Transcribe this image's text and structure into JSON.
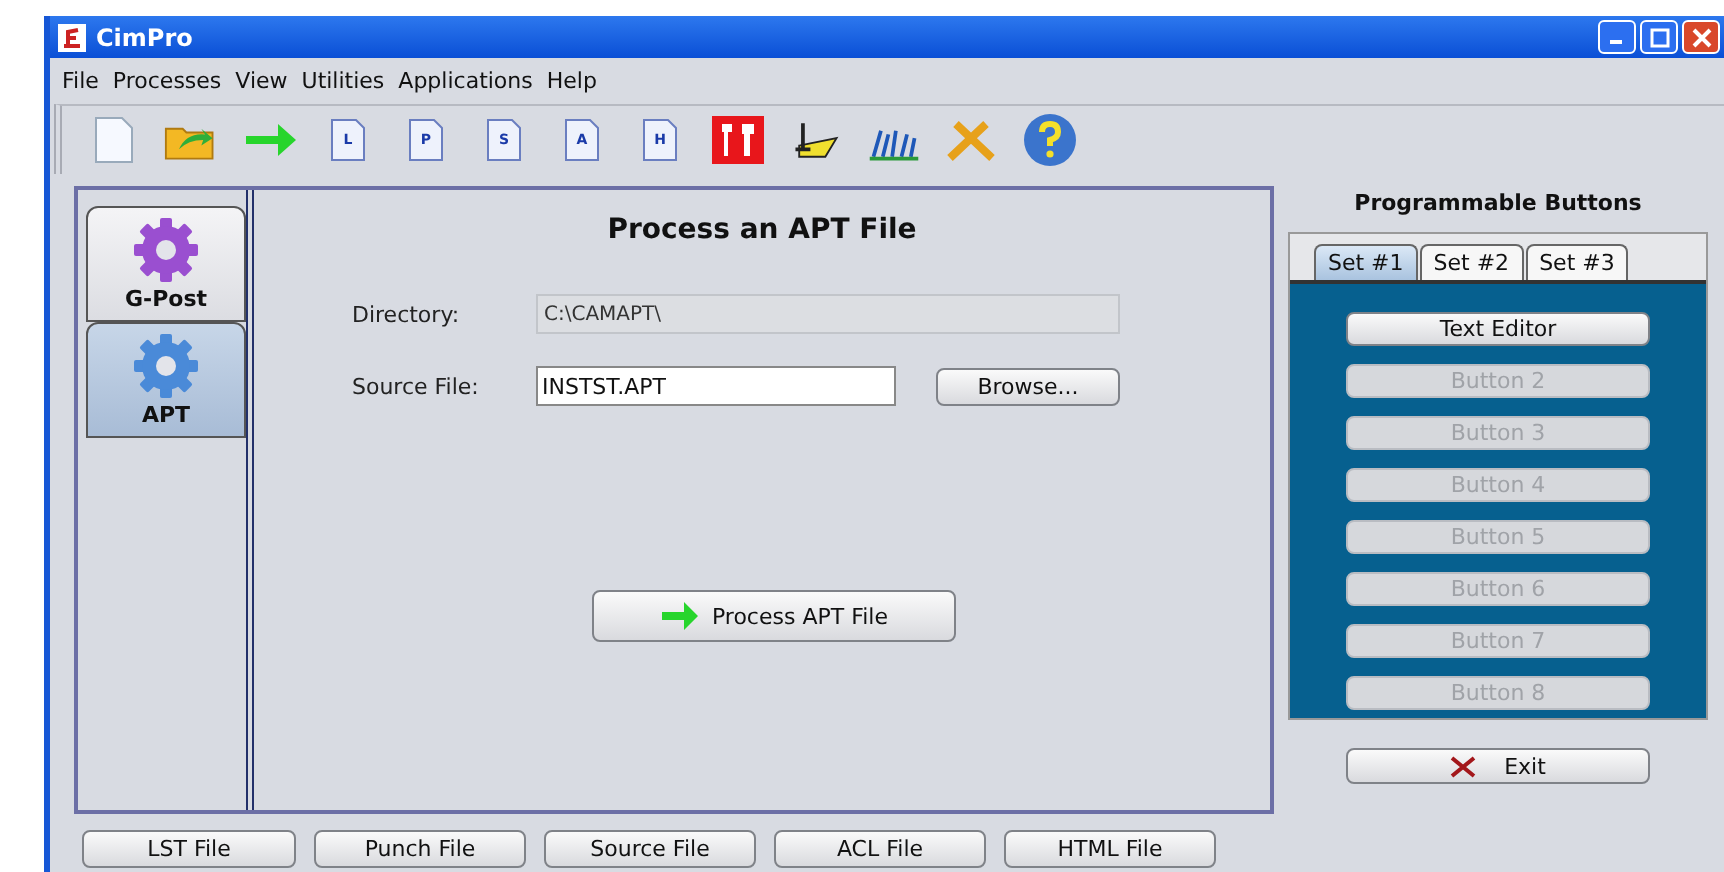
{
  "window": {
    "title": "CimPro"
  },
  "menu": [
    "File",
    "Processes",
    "View",
    "Utilities",
    "Applications",
    "Help"
  ],
  "toolbar": [
    {
      "kind": "new"
    },
    {
      "kind": "open"
    },
    {
      "kind": "go"
    },
    {
      "kind": "doc",
      "letter": "L"
    },
    {
      "kind": "doc",
      "letter": "P"
    },
    {
      "kind": "doc",
      "letter": "S"
    },
    {
      "kind": "doc",
      "letter": "A"
    },
    {
      "kind": "doc",
      "letter": "H"
    },
    {
      "kind": "tools-red"
    },
    {
      "kind": "pen"
    },
    {
      "kind": "chart"
    },
    {
      "kind": "wrench"
    },
    {
      "kind": "help"
    }
  ],
  "modules": [
    {
      "label": "G-Post",
      "color": "#9a4fd0",
      "selected": false
    },
    {
      "label": "APT",
      "color": "#4a8ad8",
      "selected": true
    }
  ],
  "panel": {
    "title": "Process an APT File",
    "directory": {
      "label": "Directory:",
      "value": "C:\\CAMAPT\\"
    },
    "source": {
      "label": "Source File:",
      "value": "INSTST.APT"
    },
    "browse": "Browse...",
    "process": "Process APT File"
  },
  "programmable": {
    "title": "Programmable Buttons",
    "tabs": [
      {
        "label": "Set #1",
        "selected": true
      },
      {
        "label": "Set #2",
        "selected": false
      },
      {
        "label": "Set #3",
        "selected": false
      }
    ],
    "buttons": [
      {
        "label": "Text Editor",
        "disabled": false
      },
      {
        "label": "Button 2",
        "disabled": true
      },
      {
        "label": "Button 3",
        "disabled": true
      },
      {
        "label": "Button 4",
        "disabled": true
      },
      {
        "label": "Button 5",
        "disabled": true
      },
      {
        "label": "Button 6",
        "disabled": true
      },
      {
        "label": "Button 7",
        "disabled": true
      },
      {
        "label": "Button 8",
        "disabled": true
      }
    ],
    "exit": "Exit"
  },
  "file_buttons": [
    "LST File",
    "Punch File",
    "Source File",
    "ACL File",
    "HTML File"
  ]
}
